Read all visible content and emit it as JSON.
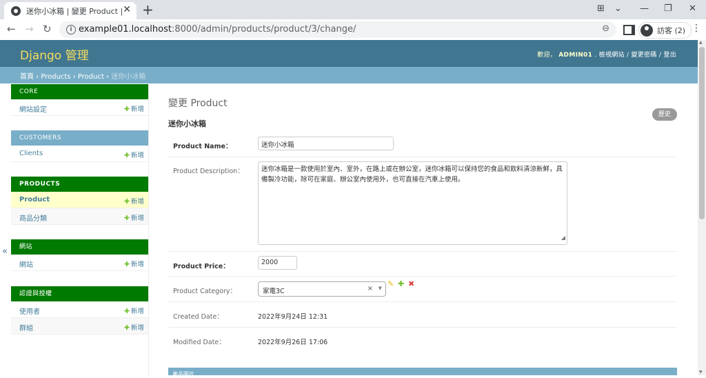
{
  "browser": {
    "tab_title": "迷你小冰箱 | 變更 Product | Django",
    "url_host": "example01.localhost",
    "url_rest": ":8000/admin/products/product/3/change/",
    "profile_label": "訪客 (2)"
  },
  "header": {
    "branding": "Django 管理",
    "welcome": "歡迎，",
    "username": "ADMIN01",
    "links": ". 檢視網站 / 變更密碼 / 登出"
  },
  "breadcrumbs": {
    "home": "首頁",
    "app": "Products",
    "model": "Product",
    "current": "迷你小冰箱"
  },
  "sidebar": {
    "add_label": "新增",
    "modules": [
      {
        "caption": "CORE",
        "items": [
          {
            "label": "網站設定"
          }
        ]
      },
      {
        "caption": "CUSTOMERS",
        "items": [
          {
            "label": "Clients"
          }
        ]
      },
      {
        "caption": "PRODUCTS",
        "items": [
          {
            "label": "Product"
          },
          {
            "label": "商品分類"
          }
        ]
      },
      {
        "caption": "網站",
        "items": [
          {
            "label": "網站"
          }
        ]
      },
      {
        "caption": "認證與授權",
        "items": [
          {
            "label": "使用者"
          },
          {
            "label": "群組"
          }
        ]
      }
    ],
    "collapse": "«"
  },
  "content": {
    "page_title": "變更 Product",
    "object_title": "迷你小冰箱",
    "history": "歷史",
    "fields": {
      "name_label": "Product Name：",
      "name_value": "迷你小冰箱",
      "desc_label": "Product Description：",
      "desc_value": "迷你冰箱是一款使用於室內、室外，在路上或在辦公室，迷你冰箱可以保持您的食品和飲料清涼新鮮，具備製冷功能，除可在家庭、辦公室內使用外，也可直接在汽車上使用。",
      "price_label": "Product Price：",
      "price_value": "2000",
      "category_label": "Product Category：",
      "category_value": "家電3C",
      "created_label": "Created Date：",
      "created_value": "2022年9月24日 12:31",
      "modified_label": "Modified Date：",
      "modified_value": "2022年9月26日 17:06"
    },
    "inline_title": "產品圖片"
  }
}
